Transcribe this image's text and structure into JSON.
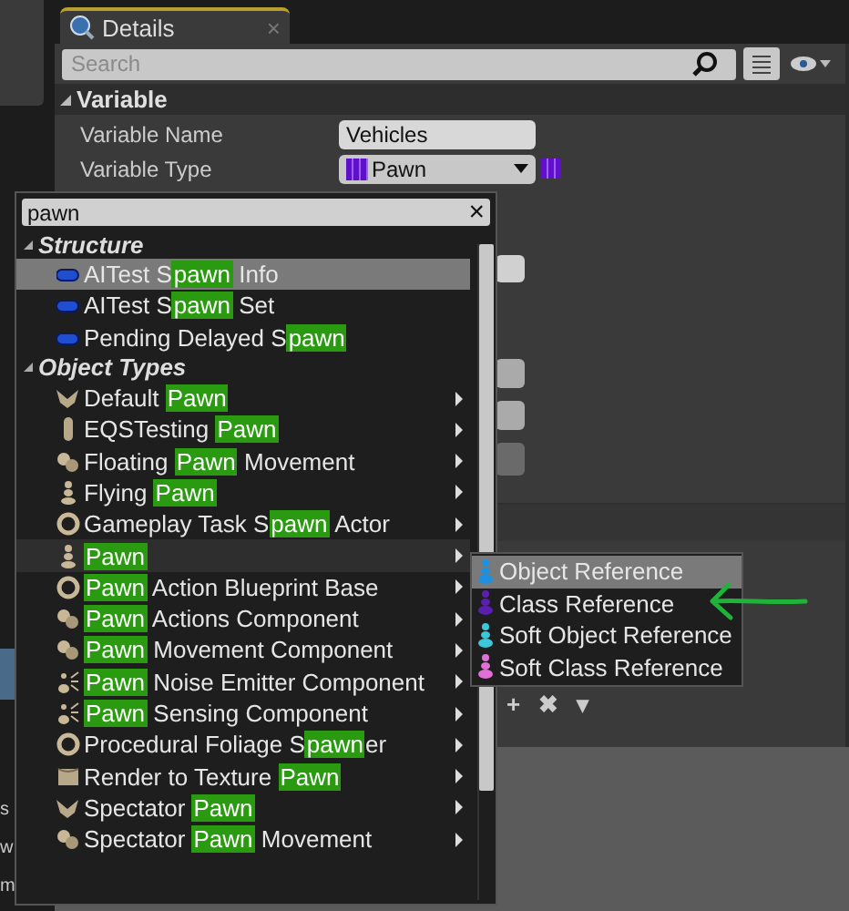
{
  "left_fragments": [
    "s",
    "w",
    "m"
  ],
  "details": {
    "tab": {
      "title": "Details",
      "close": "×"
    },
    "search": {
      "placeholder": "Search"
    },
    "section": {
      "title": "Variable",
      "expanded": true
    },
    "rows": [
      {
        "label": "Variable Name",
        "kind": "text",
        "value": "Vehicles"
      },
      {
        "label": "Variable Type",
        "kind": "type",
        "value": "Pawn"
      }
    ],
    "footer_buttons": [
      "+",
      "✖",
      "▾"
    ]
  },
  "menu": {
    "search": {
      "value": "pawn",
      "clear": "×"
    },
    "groups": [
      {
        "title": "Structure",
        "expanded": true,
        "items": [
          {
            "kind": "struct",
            "selected": true,
            "open": false,
            "parts": [
              {
                "text": "AITest S",
                "match": false
              },
              {
                "text": "pawn",
                "match": true
              },
              {
                "text": " Info",
                "match": false
              }
            ]
          },
          {
            "kind": "struct",
            "selected": false,
            "open": false,
            "parts": [
              {
                "text": "AITest S",
                "match": false
              },
              {
                "text": "pawn",
                "match": true
              },
              {
                "text": " Set",
                "match": false
              }
            ]
          },
          {
            "kind": "struct",
            "selected": false,
            "open": false,
            "parts": [
              {
                "text": "Pending Delayed S",
                "match": false
              },
              {
                "text": "pawn",
                "match": true
              }
            ]
          }
        ]
      },
      {
        "title": "Object Types",
        "expanded": true,
        "items": [
          {
            "kind": "wings",
            "selected": false,
            "open": false,
            "parts": [
              {
                "text": "Default ",
                "match": false
              },
              {
                "text": "Pawn",
                "match": true
              }
            ]
          },
          {
            "kind": "capsule",
            "selected": false,
            "open": false,
            "parts": [
              {
                "text": "EQSTesting ",
                "match": false
              },
              {
                "text": "Pawn",
                "match": true
              }
            ]
          },
          {
            "kind": "blobs",
            "selected": false,
            "open": false,
            "parts": [
              {
                "text": "Floating ",
                "match": false
              },
              {
                "text": "Pawn",
                "match": true
              },
              {
                "text": " Movement",
                "match": false
              }
            ]
          },
          {
            "kind": "figure",
            "selected": false,
            "open": false,
            "parts": [
              {
                "text": "Flying ",
                "match": false
              },
              {
                "text": "Pawn",
                "match": true
              }
            ]
          },
          {
            "kind": "ring",
            "selected": false,
            "open": false,
            "parts": [
              {
                "text": "Gameplay Task S",
                "match": false
              },
              {
                "text": "pawn",
                "match": true
              },
              {
                "text": " Actor",
                "match": false
              }
            ]
          },
          {
            "kind": "figure",
            "selected": false,
            "open": true,
            "parts": [
              {
                "text": "Pawn",
                "match": true
              }
            ]
          },
          {
            "kind": "ring",
            "selected": false,
            "open": false,
            "parts": [
              {
                "text": "Pawn",
                "match": true
              },
              {
                "text": " Action Blueprint Base",
                "match": false
              }
            ]
          },
          {
            "kind": "blobs",
            "selected": false,
            "open": false,
            "parts": [
              {
                "text": "Pawn",
                "match": true
              },
              {
                "text": " Actions Component",
                "match": false
              }
            ]
          },
          {
            "kind": "blobs",
            "selected": false,
            "open": false,
            "parts": [
              {
                "text": "Pawn",
                "match": true
              },
              {
                "text": " Movement Component",
                "match": false
              }
            ]
          },
          {
            "kind": "noise",
            "selected": false,
            "open": false,
            "parts": [
              {
                "text": "Pawn",
                "match": true
              },
              {
                "text": " Noise Emitter Component",
                "match": false
              }
            ]
          },
          {
            "kind": "noise",
            "selected": false,
            "open": false,
            "parts": [
              {
                "text": "Pawn",
                "match": true
              },
              {
                "text": " Sensing Component",
                "match": false
              }
            ]
          },
          {
            "kind": "ring",
            "selected": false,
            "open": false,
            "parts": [
              {
                "text": "Procedural Foliage S",
                "match": false
              },
              {
                "text": "pawn",
                "match": true
              },
              {
                "text": "er",
                "match": false
              }
            ]
          },
          {
            "kind": "scroll",
            "selected": false,
            "open": false,
            "parts": [
              {
                "text": "Render to Texture ",
                "match": false
              },
              {
                "text": "Pawn",
                "match": true
              }
            ]
          },
          {
            "kind": "wings",
            "selected": false,
            "open": false,
            "parts": [
              {
                "text": "Spectator ",
                "match": false
              },
              {
                "text": "Pawn",
                "match": true
              }
            ]
          },
          {
            "kind": "blobs",
            "selected": false,
            "open": false,
            "parts": [
              {
                "text": "Spectator ",
                "match": false
              },
              {
                "text": "Pawn",
                "match": true
              },
              {
                "text": " Movement",
                "match": false
              }
            ]
          }
        ]
      }
    ]
  },
  "submenu": {
    "items": [
      {
        "label": "Object Reference",
        "color": "#1e90e0",
        "selected": true
      },
      {
        "label": "Class Reference",
        "color": "#5a1fb0",
        "selected": false
      },
      {
        "label": "Soft Object Reference",
        "color": "#3cc8d8",
        "selected": false
      },
      {
        "label": "Soft Class Reference",
        "color": "#e070d8",
        "selected": false
      }
    ]
  }
}
